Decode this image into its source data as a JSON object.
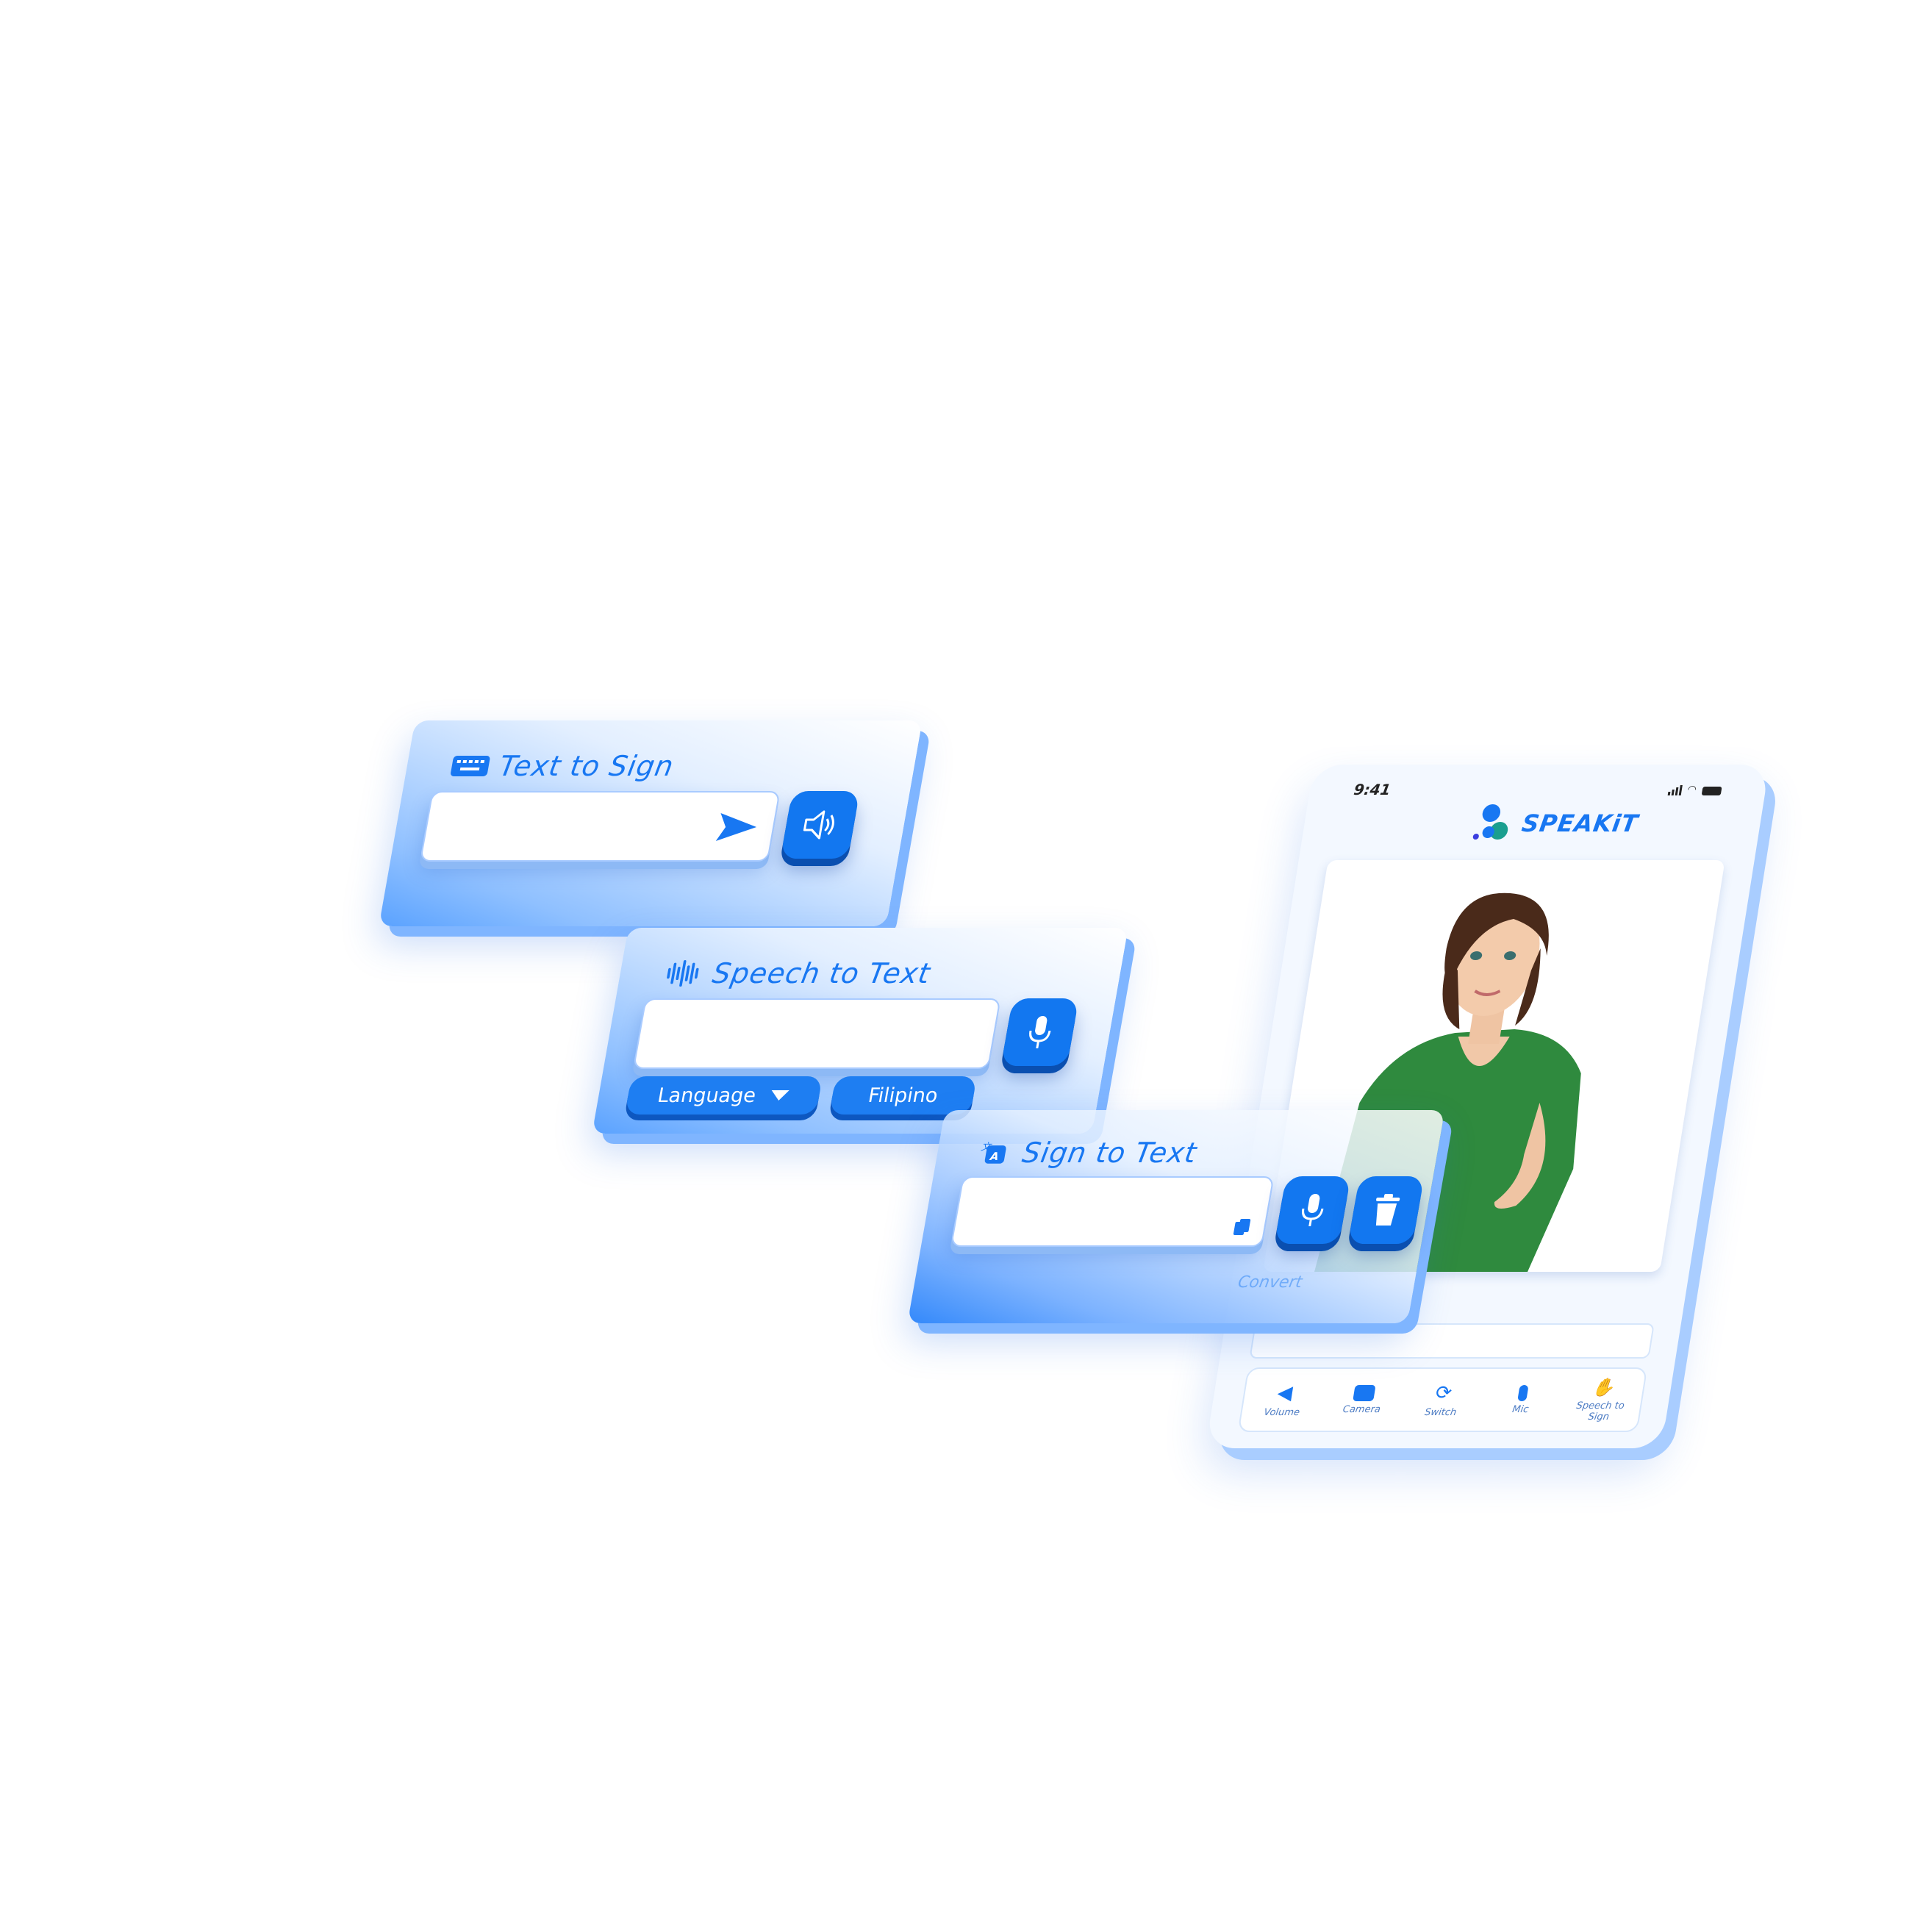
{
  "text_to_sign": {
    "title": "Text to Sign",
    "icon": "keyboard-icon",
    "send_icon": "send-icon",
    "speaker_icon": "speaker-icon"
  },
  "speech_to_text": {
    "title": "Speech to Text",
    "icon": "waveform-icon",
    "mic_icon": "microphone-icon",
    "language_label": "Language",
    "language_value": "Filipino"
  },
  "sign_to_text": {
    "title": "Sign to Text",
    "icon": "translate-icon",
    "copy_icon": "copy-icon",
    "mic_icon": "microphone-icon",
    "delete_icon": "trash-icon",
    "convert_label": "Convert"
  },
  "phone": {
    "time": "9:41",
    "app_name": "SPEAKiT",
    "status_icons": [
      "signal-icon",
      "wifi-icon",
      "battery-icon"
    ],
    "nav": [
      {
        "label": "Volume",
        "icon": "volume-icon"
      },
      {
        "label": "Camera",
        "icon": "camera-icon"
      },
      {
        "label": "Switch",
        "icon": "switch-camera-icon"
      },
      {
        "label": "Mic",
        "icon": "microphone-icon"
      },
      {
        "label": "Speech to Sign",
        "icon": "speech-to-sign-icon"
      }
    ]
  },
  "colors": {
    "accent": "#1877f2",
    "panel_light": "#e3efff",
    "panel_dark": "#5aa2ff"
  }
}
